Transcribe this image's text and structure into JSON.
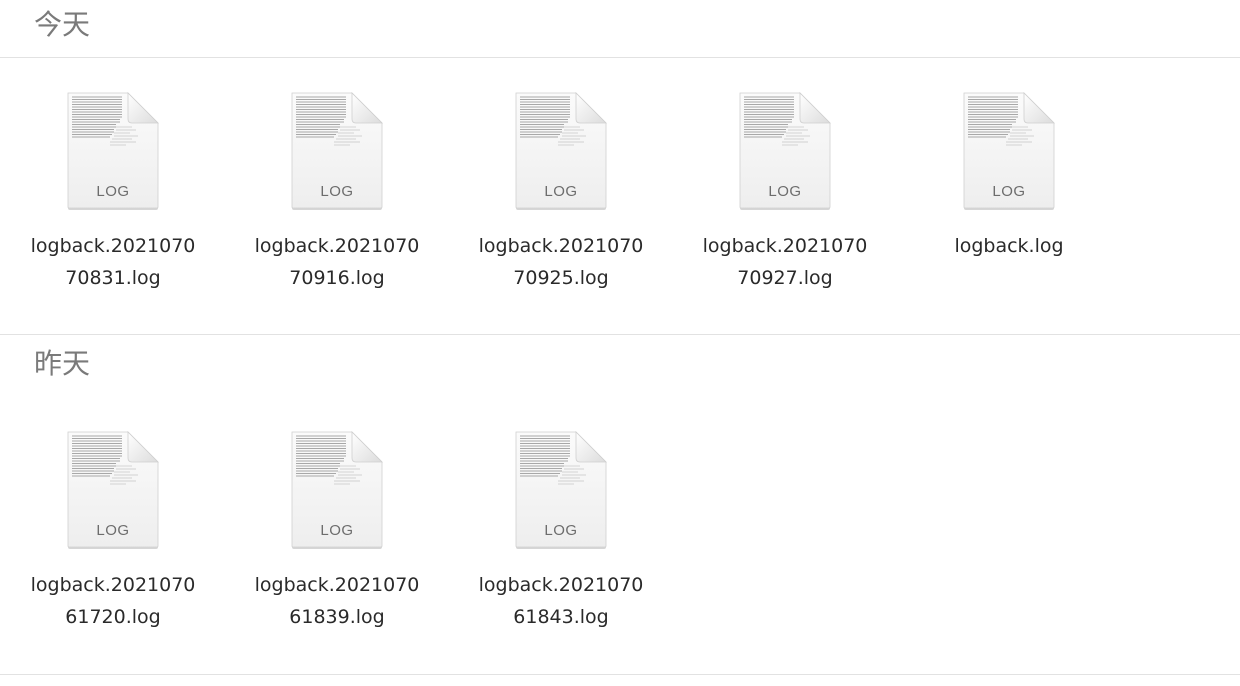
{
  "groups": [
    {
      "title": "今天",
      "files": [
        {
          "name_line1": "logback.2021070",
          "name_line2": "70831.log",
          "type_badge": "LOG",
          "icon": "log-file-icon"
        },
        {
          "name_line1": "logback.2021070",
          "name_line2": "70916.log",
          "type_badge": "LOG",
          "icon": "log-file-icon"
        },
        {
          "name_line1": "logback.2021070",
          "name_line2": "70925.log",
          "type_badge": "LOG",
          "icon": "log-file-icon"
        },
        {
          "name_line1": "logback.2021070",
          "name_line2": "70927.log",
          "type_badge": "LOG",
          "icon": "log-file-icon"
        },
        {
          "name_line1": "logback.log",
          "name_line2": "",
          "type_badge": "LOG",
          "icon": "log-file-icon"
        }
      ]
    },
    {
      "title": "昨天",
      "files": [
        {
          "name_line1": "logback.2021070",
          "name_line2": "61720.log",
          "type_badge": "LOG",
          "icon": "log-file-icon"
        },
        {
          "name_line1": "logback.2021070",
          "name_line2": "61839.log",
          "type_badge": "LOG",
          "icon": "log-file-icon"
        },
        {
          "name_line1": "logback.2021070",
          "name_line2": "61843.log",
          "type_badge": "LOG",
          "icon": "log-file-icon"
        }
      ]
    }
  ],
  "colors": {
    "header_text": "#7a7a7a",
    "divider": "#e2e2e2",
    "filename_text": "#2a2a2a"
  }
}
